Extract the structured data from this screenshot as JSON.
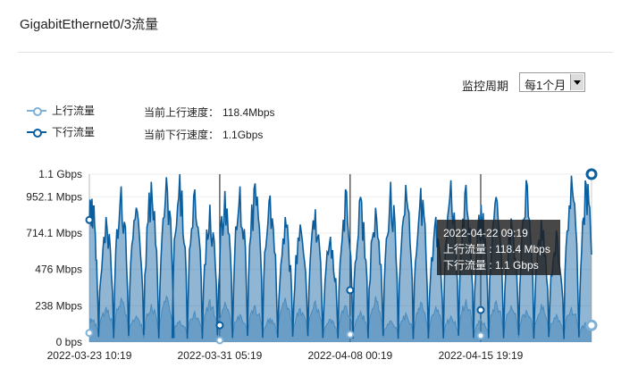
{
  "header": {
    "title": "GigabitEthernet0/3流量"
  },
  "controls": {
    "period_label": "监控周期",
    "period_value": "每1个月"
  },
  "legend": [
    {
      "label": "上行流量",
      "color": "#7fb1d6"
    },
    {
      "label": "下行流量",
      "color": "#0b5e9e"
    }
  ],
  "current": {
    "up_label": "当前上行速度：",
    "up_value": "118.4Mbps",
    "down_label": "当前下行速度：",
    "down_value": "1.1Gbps"
  },
  "tooltip": {
    "time": "2022-04-22 09:19",
    "up": "上行流量 : 118.4 Mbps",
    "down": "下行流量 : 1.1 Gbps"
  },
  "chart_data": {
    "type": "area",
    "y_tick_labels": [
      "1.1 Gbps",
      "952.1 Mbps",
      "714.1 Mbps",
      "476 Mbps",
      "238 Mbps",
      "0 bps"
    ],
    "y_tick_values": [
      1100,
      952.1,
      714.1,
      476,
      238,
      0
    ],
    "ylim": [
      0,
      1100
    ],
    "y_unit": "Mbps",
    "x_tick_labels": [
      "2022-03-23 10:19",
      "2022-03-31 05:19",
      "2022-04-08 00:19",
      "2022-04-15 19:19"
    ],
    "x_range_days": [
      0,
      30
    ],
    "x_tick_days": [
      0,
      7.79,
      15.58,
      23.38
    ],
    "grid": true,
    "series": [
      {
        "name": "上行流量",
        "color": "#7fb1d6",
        "peaks": [
          [
            0.1,
            160
          ],
          [
            1.0,
            230
          ],
          [
            1.9,
            290
          ],
          [
            2.8,
            170
          ],
          [
            3.7,
            250
          ],
          [
            4.6,
            300
          ],
          [
            5.4,
            140
          ],
          [
            6.3,
            200
          ],
          [
            7.2,
            280
          ],
          [
            8.1,
            260
          ],
          [
            9.0,
            180
          ],
          [
            9.9,
            240
          ],
          [
            10.8,
            160
          ],
          [
            11.7,
            290
          ],
          [
            12.6,
            220
          ],
          [
            13.5,
            270
          ],
          [
            14.4,
            150
          ],
          [
            15.3,
            240
          ],
          [
            16.2,
            200
          ],
          [
            17.1,
            300
          ],
          [
            18.0,
            140
          ],
          [
            18.9,
            190
          ],
          [
            19.8,
            260
          ],
          [
            20.7,
            230
          ],
          [
            21.6,
            170
          ],
          [
            22.5,
            280
          ],
          [
            23.4,
            150
          ],
          [
            24.3,
            270
          ],
          [
            25.2,
            240
          ],
          [
            26.1,
            210
          ],
          [
            27.0,
            250
          ],
          [
            27.9,
            180
          ],
          [
            28.8,
            230
          ],
          [
            29.7,
            130
          ]
        ],
        "markers": [
          [
            0,
            60
          ],
          [
            7.79,
            12
          ],
          [
            15.58,
            50
          ],
          [
            23.38,
            42
          ],
          [
            30,
            110
          ]
        ]
      },
      {
        "name": "下行流量",
        "color": "#0b5e9e",
        "peaks": [
          [
            0.1,
            1000
          ],
          [
            1.0,
            820
          ],
          [
            1.9,
            1020
          ],
          [
            2.8,
            880
          ],
          [
            3.7,
            1050
          ],
          [
            4.6,
            1080
          ],
          [
            5.4,
            1100
          ],
          [
            6.3,
            1000
          ],
          [
            7.2,
            900
          ],
          [
            8.1,
            990
          ],
          [
            9.0,
            1020
          ],
          [
            9.9,
            1040
          ],
          [
            10.8,
            960
          ],
          [
            11.7,
            820
          ],
          [
            12.6,
            770
          ],
          [
            13.5,
            870
          ],
          [
            14.4,
            690
          ],
          [
            15.3,
            1000
          ],
          [
            16.2,
            950
          ],
          [
            17.1,
            880
          ],
          [
            18.0,
            1050
          ],
          [
            18.9,
            1030
          ],
          [
            19.8,
            1010
          ],
          [
            20.7,
            820
          ],
          [
            21.6,
            1060
          ],
          [
            22.5,
            1030
          ],
          [
            23.4,
            900
          ],
          [
            24.3,
            950
          ],
          [
            25.2,
            810
          ],
          [
            26.1,
            1060
          ],
          [
            27.0,
            800
          ],
          [
            27.9,
            730
          ],
          [
            28.8,
            1090
          ],
          [
            29.7,
            1080
          ]
        ],
        "markers": [
          [
            0,
            800
          ],
          [
            7.79,
            110
          ],
          [
            15.58,
            340
          ],
          [
            23.38,
            210
          ],
          [
            30,
            1100
          ]
        ]
      }
    ]
  }
}
